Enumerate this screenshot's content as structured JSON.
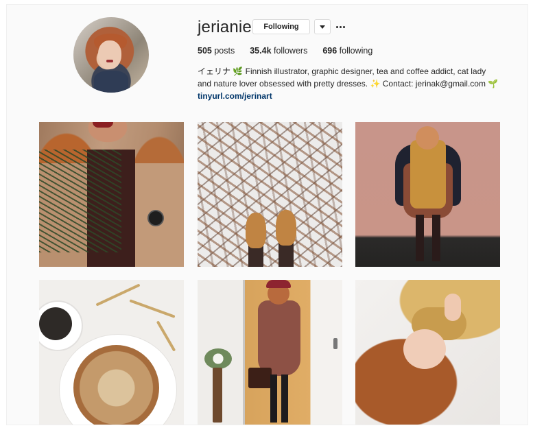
{
  "profile": {
    "username": "jerianie",
    "following_button": "Following",
    "stats": {
      "posts_count": "505",
      "posts_label": "posts",
      "followers_count": "35.4k",
      "followers_label": "followers",
      "following_count": "696",
      "following_label": "following"
    },
    "bio": {
      "line1": "イェリナ 🌿 Finnish illustrator, graphic designer, tea and coffee addict, cat lady",
      "line2": "and nature lover obsessed with pretty dresses. ✨ Contact: jerinak@gmail.com 🌱",
      "link": "tinyurl.com/jerinart"
    }
  },
  "posts": [
    {
      "subject": "woman in camel coat with wristwatch and pine branches"
    },
    {
      "subject": "tan boots on snow with fallen leaves"
    },
    {
      "subject": "woman in mustard scarf against pink wall"
    },
    {
      "subject": "pecan cake with coffee and golden twigs"
    },
    {
      "subject": "woman in patterned dress with red beret and brown bag"
    },
    {
      "subject": "woman in mustard knit hat lying in snow"
    }
  ],
  "colors": {
    "text": "#262626",
    "link": "#003569",
    "border": "#dbdbdb",
    "background": "#fafafa"
  }
}
